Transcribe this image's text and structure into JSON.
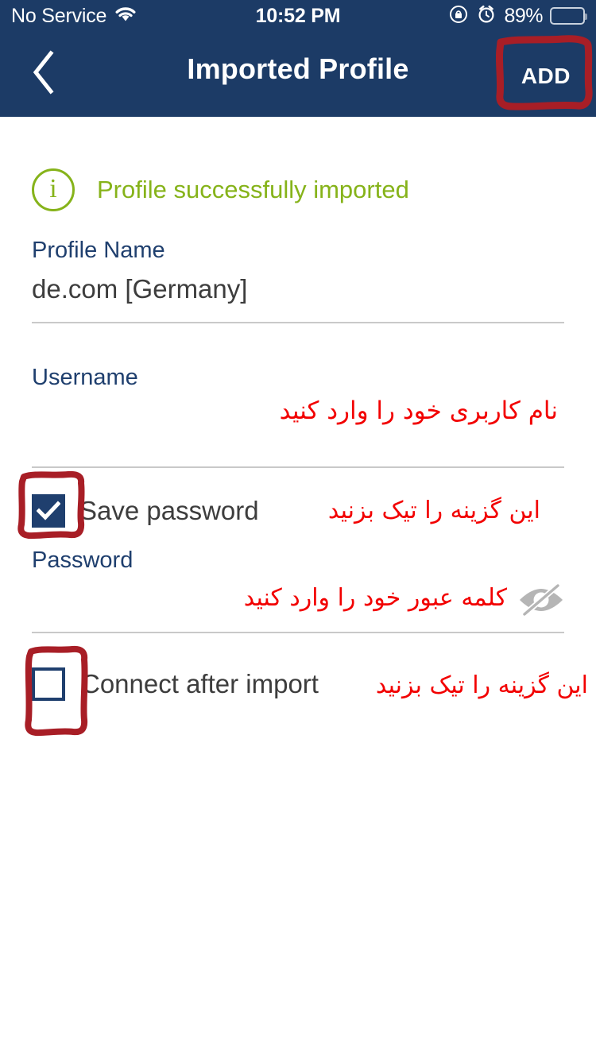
{
  "status_bar": {
    "carrier": "No Service",
    "wifi_icon": "wifi-icon",
    "time": "10:52 PM",
    "rotation_lock_icon": "rotation-lock-icon",
    "alarm_icon": "alarm-clock-icon",
    "battery_percent": "89%",
    "battery_icon": "battery-charging-icon"
  },
  "nav_bar": {
    "back_icon": "chevron-left-icon",
    "title": "Imported Profile",
    "add_label": "ADD"
  },
  "content": {
    "status_message": "Profile successfully imported",
    "status_icon": "info-circle-icon",
    "profile_name": {
      "label": "Profile Name",
      "value": "de.com   [Germany]"
    },
    "username": {
      "label": "Username",
      "value": ""
    },
    "save_password": {
      "label": "Save password",
      "checked": true
    },
    "password": {
      "label": "Password",
      "value": "",
      "visibility_icon": "eye-slash-icon"
    },
    "connect_after_import": {
      "label": "Connect after import",
      "checked": false
    }
  },
  "annotations": {
    "username_hint": "نام کاربری خود را وارد کنید",
    "save_password_hint": "این گزینه را تیک بزنید",
    "password_hint": "کلمه عبور خود را وارد کنید",
    "connect_hint": "این گزینه را تیک بزنید"
  },
  "colors": {
    "nav_background": "#1c3b66",
    "accent_blue": "#1f3f6e",
    "success_green": "#86b31a",
    "annotation_red": "#f20000",
    "marker_red": "#a81e26",
    "divider_gray": "#c9c9c9"
  }
}
